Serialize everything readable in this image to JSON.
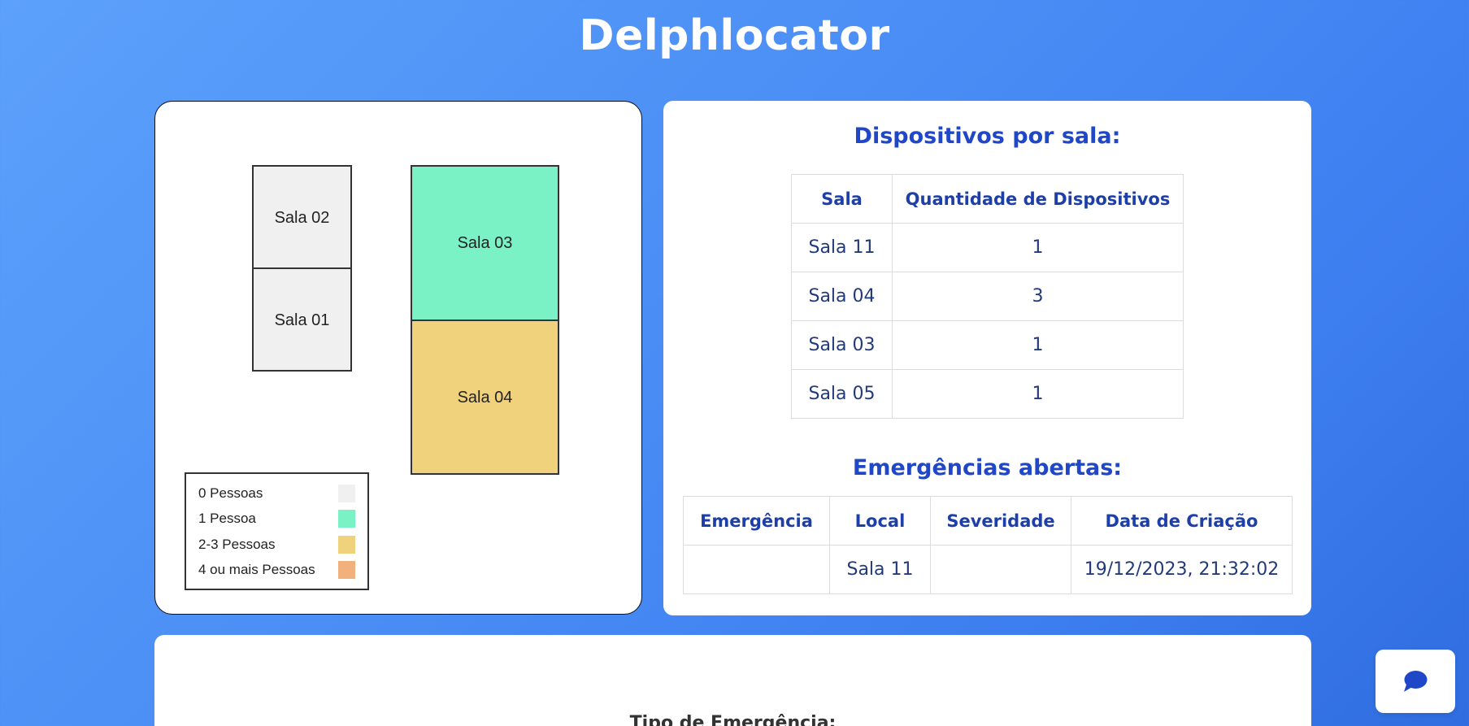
{
  "app": {
    "title": "Delphlocator"
  },
  "map": {
    "rooms": [
      {
        "label": "Sala 02",
        "color": "#f0f0f0"
      },
      {
        "label": "Sala 01",
        "color": "#f0f0f0"
      },
      {
        "label": "Sala 03",
        "color": "#7af2c6"
      },
      {
        "label": "Sala 04",
        "color": "#f0d17c"
      }
    ],
    "legend": [
      {
        "label": "0 Pessoas",
        "color": "#f0f0f0"
      },
      {
        "label": "1 Pessoa",
        "color": "#7af2c6"
      },
      {
        "label": "2-3 Pessoas",
        "color": "#f0d17c"
      },
      {
        "label": "4 ou mais Pessoas",
        "color": "#f2b07c"
      }
    ]
  },
  "devices": {
    "title": "Dispositivos por sala:",
    "headers": {
      "room": "Sala",
      "count": "Quantidade de Dispositivos"
    },
    "rows": [
      {
        "room": "Sala 11",
        "count": "1"
      },
      {
        "room": "Sala 04",
        "count": "3"
      },
      {
        "room": "Sala 03",
        "count": "1"
      },
      {
        "room": "Sala 05",
        "count": "1"
      }
    ]
  },
  "emergencies": {
    "title": "Emergências abertas:",
    "headers": {
      "emergency": "Emergência",
      "location": "Local",
      "severity": "Severidade",
      "created": "Data de Criação"
    },
    "rows": [
      {
        "emergency": "",
        "location": "Sala 11",
        "severity": "",
        "created": "19/12/2023, 21:32:02"
      }
    ]
  },
  "form": {
    "emergency_type_label": "Tipo de Emergência:"
  },
  "chat": {
    "icon": "chat-bubble-icon",
    "color": "#1f47c8"
  }
}
